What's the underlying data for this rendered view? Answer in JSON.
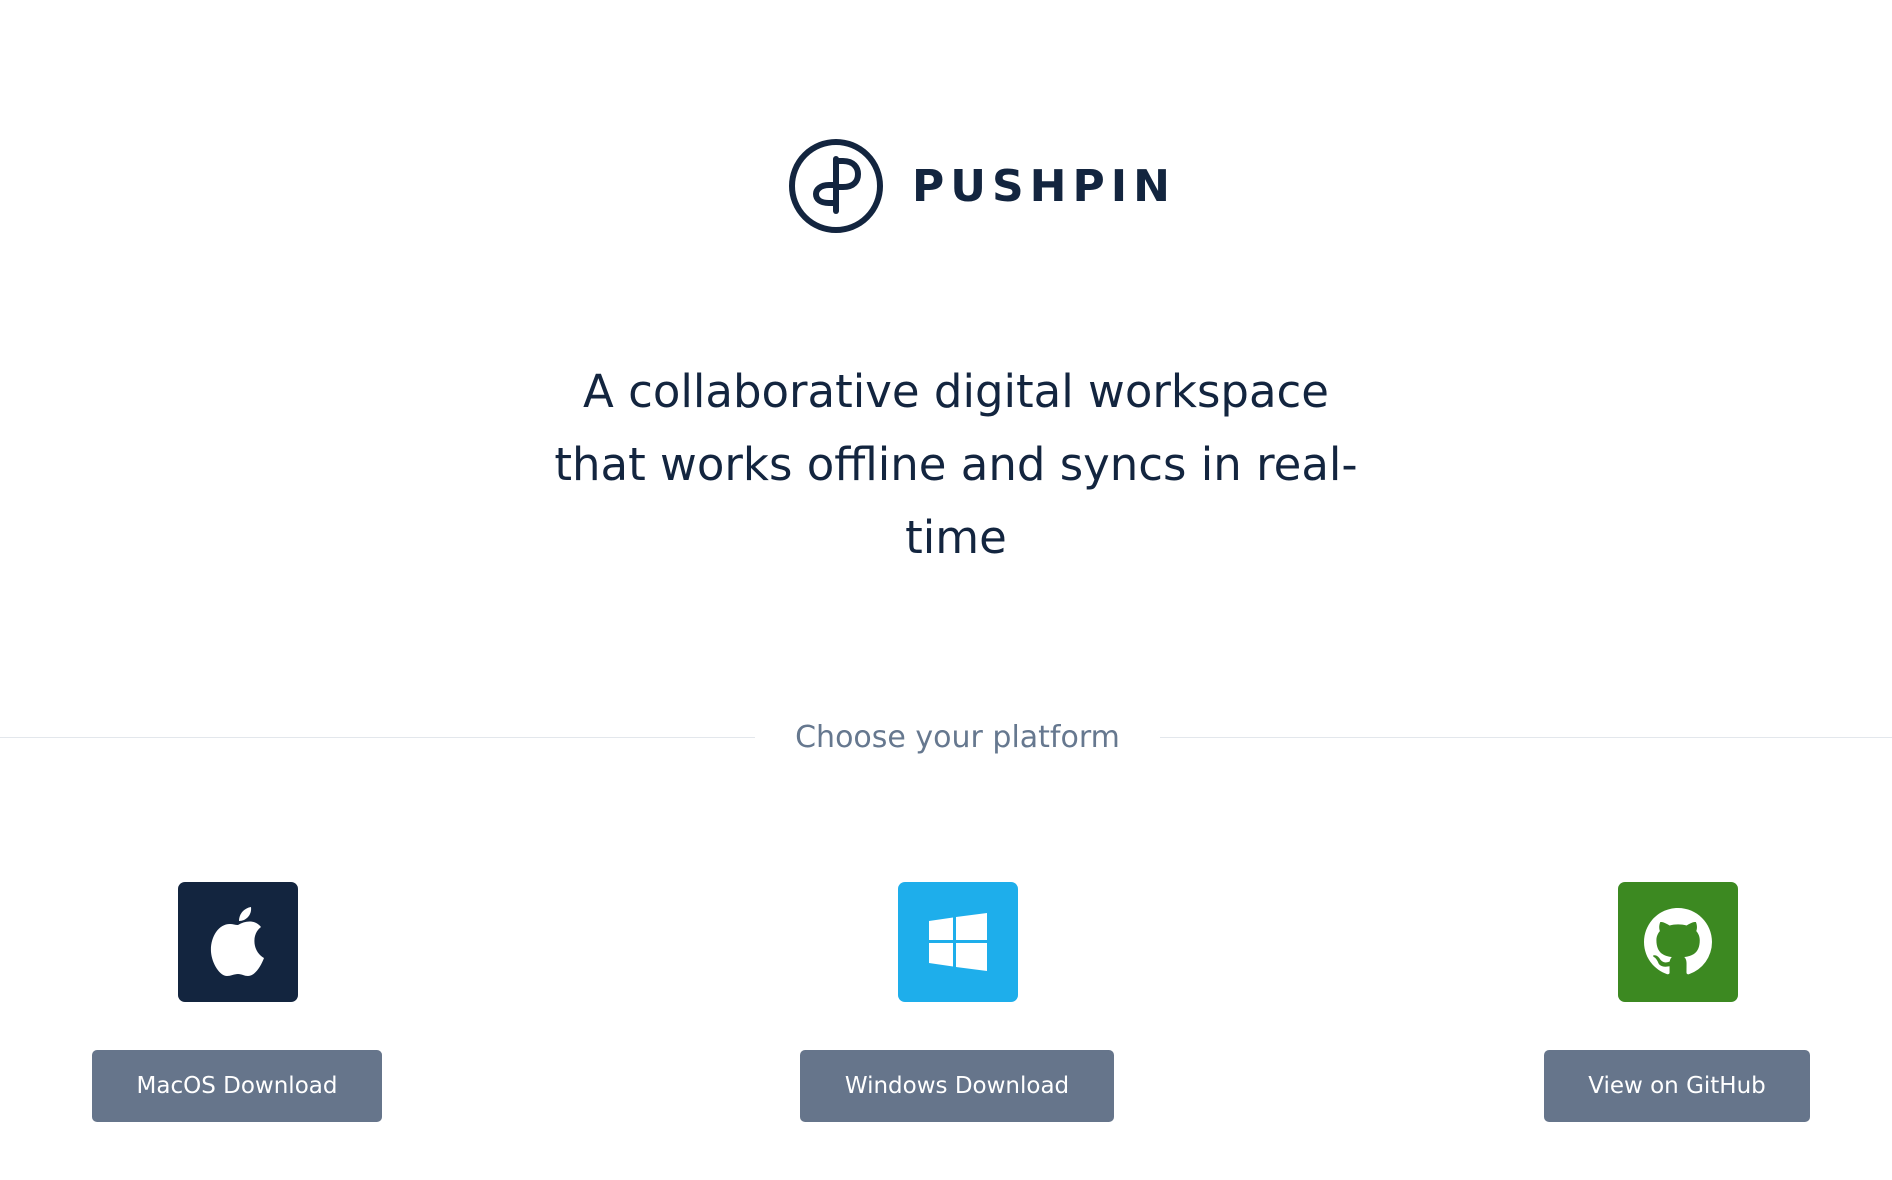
{
  "brand": {
    "name": "PUSHPIN",
    "logo_icon": "pushpin-p-logo",
    "color": "#13253f"
  },
  "hero": {
    "tagline": "A collaborative digital workspace that works offline and syncs in real-time"
  },
  "platforms": {
    "heading": "Choose your platform",
    "items": [
      {
        "id": "macos",
        "icon": "apple-icon",
        "icon_bg": "#13253f",
        "button_label": "MacOS Download"
      },
      {
        "id": "windows",
        "icon": "windows-icon",
        "icon_bg": "#1eaeeb",
        "button_label": "Windows Download"
      },
      {
        "id": "github",
        "icon": "github-icon",
        "icon_bg": "#3c8921",
        "button_label": "View on GitHub"
      }
    ]
  },
  "colors": {
    "text_primary": "#13253f",
    "text_muted": "#66788f",
    "button_bg": "#66758b",
    "divider": "#e3e7ec"
  }
}
